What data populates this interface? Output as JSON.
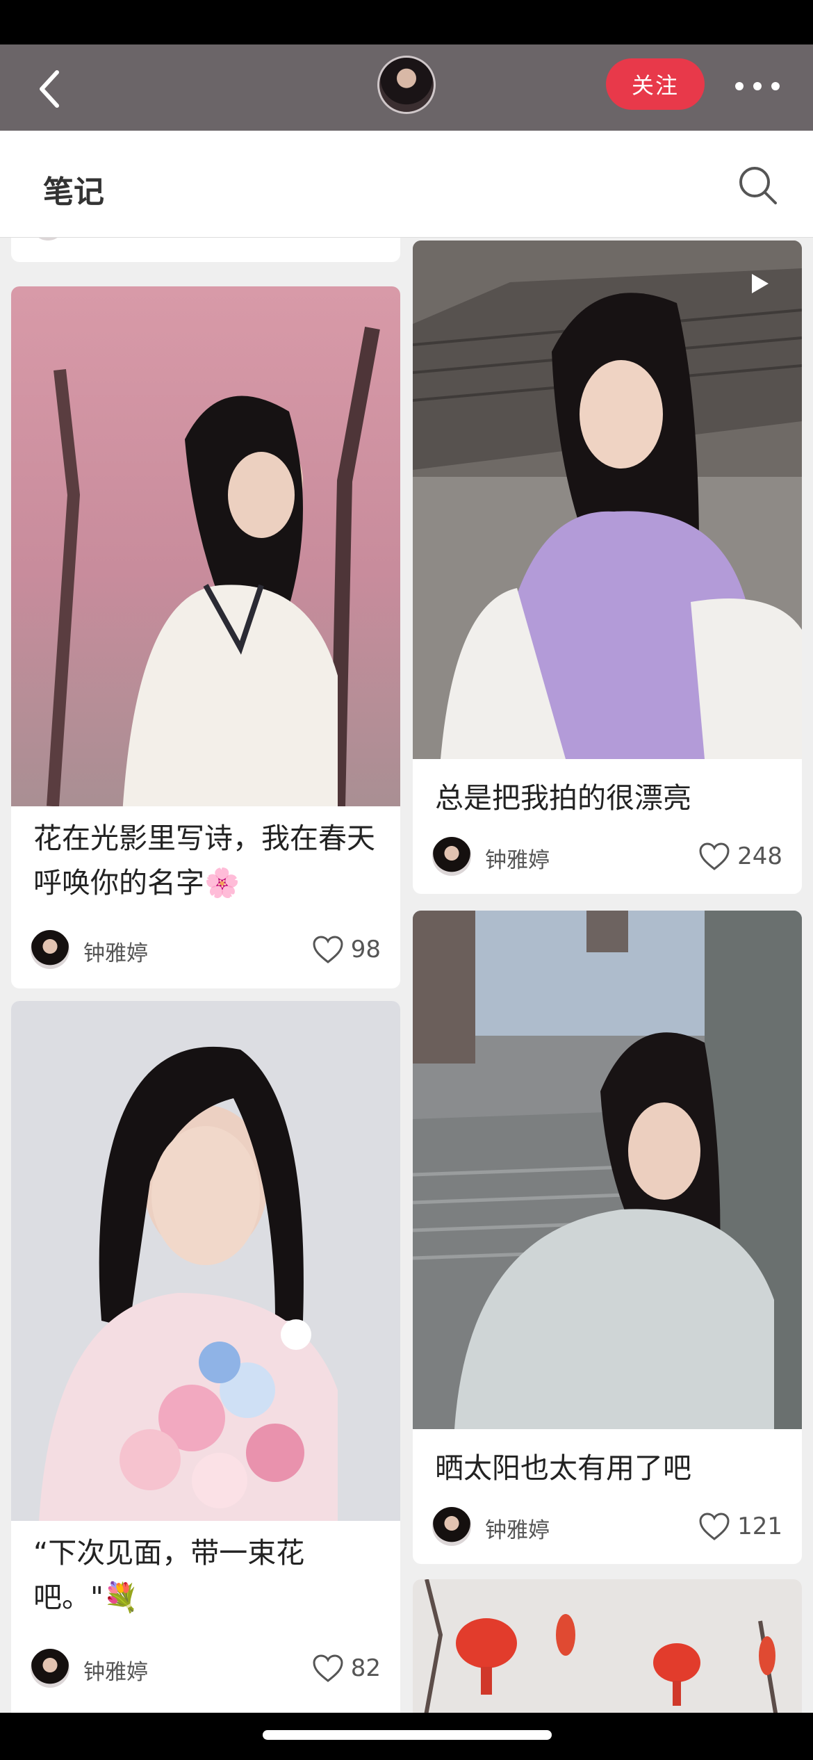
{
  "nav": {
    "back_icon": "chevron-left-icon",
    "follow_label": "关注",
    "more_icon": "more-dots-icon"
  },
  "section": {
    "title": "笔记",
    "search_icon": "search-icon"
  },
  "cards": [
    {
      "title": "花在光影里写诗，我在春天呼唤你的名字🌸",
      "author": "钟雅婷",
      "likes": "98"
    },
    {
      "title": "总是把我拍的很漂亮",
      "author": "钟雅婷",
      "likes": "248"
    },
    {
      "title": "“下次见面，带一束花吧。\"💐",
      "author": "钟雅婷",
      "likes": "82"
    },
    {
      "title": "晒太阳也太有用了吧",
      "author": "钟雅婷",
      "likes": "121"
    }
  ],
  "colors": {
    "navbar": "#6b6568",
    "follow": "#e8394a",
    "feed_bg": "#efefef"
  }
}
